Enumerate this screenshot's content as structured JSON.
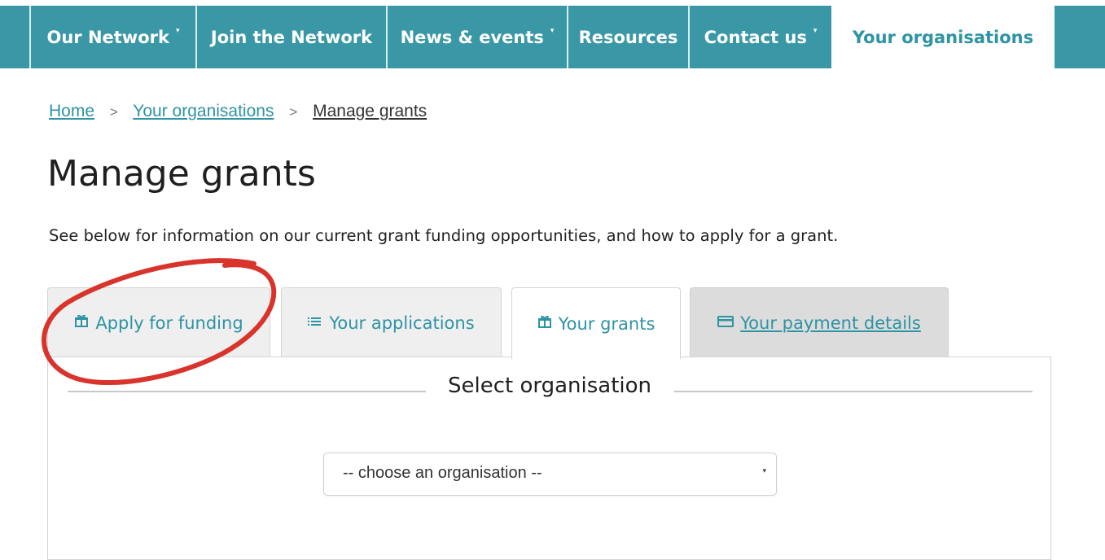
{
  "nav": {
    "items": [
      {
        "label": "Our Network",
        "caret": "▾"
      },
      {
        "label": "Join the Network"
      },
      {
        "label": "News & events",
        "caret": "▾"
      },
      {
        "label": "Resources"
      },
      {
        "label": "Contact us",
        "caret": "▾"
      },
      {
        "label": "Your organisations",
        "active": true
      }
    ],
    "caret_glyph": "▾",
    "bar_color": "#3a97a6",
    "active_text_color": "#2e93a4"
  },
  "breadcrumb": {
    "items": [
      "Home",
      "Your organisations",
      "Manage grants"
    ],
    "separator": ">"
  },
  "page": {
    "title": "Manage grants",
    "intro": "See below for information on our current grant funding opportunities, and how to apply for a grant."
  },
  "tabs": [
    {
      "label": "Apply for funding",
      "icon": "gift-icon",
      "glyph": "🎁",
      "state": "inactive"
    },
    {
      "label": "Your applications",
      "icon": "list-icon",
      "glyph": "≡",
      "state": "inactive"
    },
    {
      "label": "Your grants",
      "icon": "gift-icon",
      "glyph": "🎁",
      "state": "active"
    },
    {
      "label": "Your payment details",
      "icon": "credit-card-icon",
      "glyph": "▭",
      "state": "hover"
    }
  ],
  "panel": {
    "legend": "Select organisation",
    "select": {
      "value": "-- choose an organisation --",
      "caret": "▾"
    }
  },
  "annotation": {
    "shape": "ellipse",
    "color": "#d8342c",
    "target": "Apply for funding"
  }
}
